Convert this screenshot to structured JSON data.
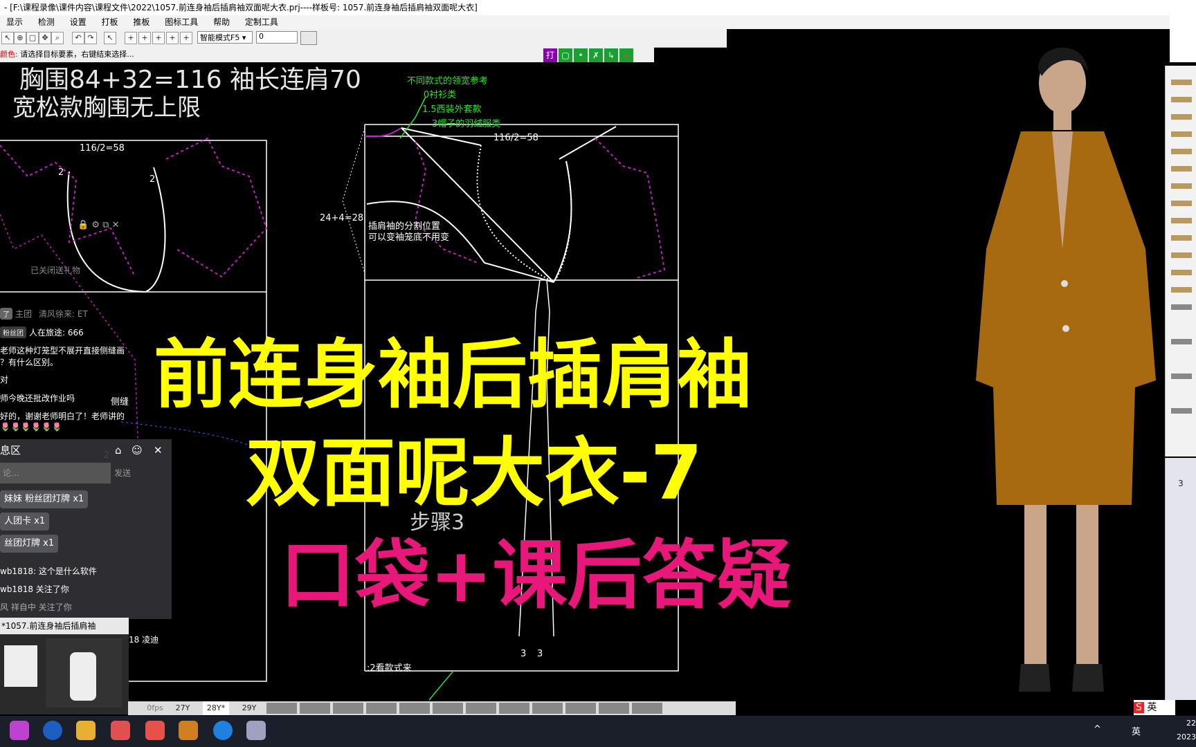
{
  "window": {
    "title": "- [F:\\课程录像\\课件内容\\课程文件\\2022\\1057.前连身袖后插肩袖双面呢大衣.prj----样板号: 1057.前连身袖后插肩袖双面呢大衣]"
  },
  "menu": [
    "显示",
    "检测",
    "设置",
    "打板",
    "推板",
    "图标工具",
    "帮助",
    "定制工具"
  ],
  "toolbar": {
    "mode_select": "智能模式F5",
    "mode_input": "0"
  },
  "status": {
    "prefix": "颜色:",
    "message": "请选择目标要素，右键结束选择..."
  },
  "quick_buttons": [
    "打",
    "▢",
    "•",
    "✗",
    "↳",
    "a"
  ],
  "canvas": {
    "note_chest": "胸围84+32=116   袖长连肩70",
    "note_loose": "宽松款胸围无上限",
    "left_width": "116/2=58",
    "right_width": "116/2=58",
    "mark_2a": "2",
    "mark_2b": "2",
    "side_dim": "24+4=28",
    "collar_ref_title": "不同款式的领宽参考",
    "collar_ref_0": "0衬衫类",
    "collar_ref_15": "1.5西装外套款",
    "collar_ref_3": "3帽子的羽绒服类",
    "raglan_note_1": "插肩袖的分割位置",
    "raglan_note_2": "可以变袖笼底不用变",
    "step_label": "步骤3",
    "dart_3a": "3",
    "dart_3b": "3",
    "bottom_note": ":2看款式来",
    "side_seam": "侧缝",
    "mark_2c": "2"
  },
  "overlay": {
    "line1": "前连身袖后插肩袖",
    "line2": "双面呢大衣-7",
    "line3": "口袋+课后答疑"
  },
  "chat": {
    "header_left": "了",
    "header_mid": "主团",
    "header_right": "清风徐来: ET",
    "fan_badge": "粉丝团",
    "fan_user": "人在旅途:",
    "fan_count": "666",
    "msg1": "老师这种灯笼型不展开直接侧缝画",
    "msg2": "？有什么区别。",
    "msg3": "对",
    "msg4": "师今晚还批改作业吗",
    "msg5": "好的，谢谢老师明白了！老师讲的",
    "closed_gift": "已关闭送礼物",
    "panel_title": "息区",
    "input_placeholder": "论...",
    "send": "发送",
    "gift1_user": "妹妹",
    "gift1_item": "粉丝团灯牌",
    "gift1_count": "x1",
    "gift2_item": "人团卡",
    "gift2_count": "x1",
    "gift3_item": "丝团灯牌",
    "gift3_count": "x1",
    "msg6": "wb1818: 这个是什么软件",
    "msg7": "wb1818  关注了你",
    "msg8": "风  祥自中  关注了你",
    "msg9": "18 凌迪"
  },
  "thumb": {
    "title": "*1057.前连身袖后插肩袖"
  },
  "layers": [
    "27Y",
    "28Y*",
    "29Y"
  ],
  "layer_left": "0fps",
  "right_panel": {
    "number": "3"
  },
  "tray": {
    "lang": "英",
    "ime": "英",
    "time": "22",
    "date": "2023"
  }
}
